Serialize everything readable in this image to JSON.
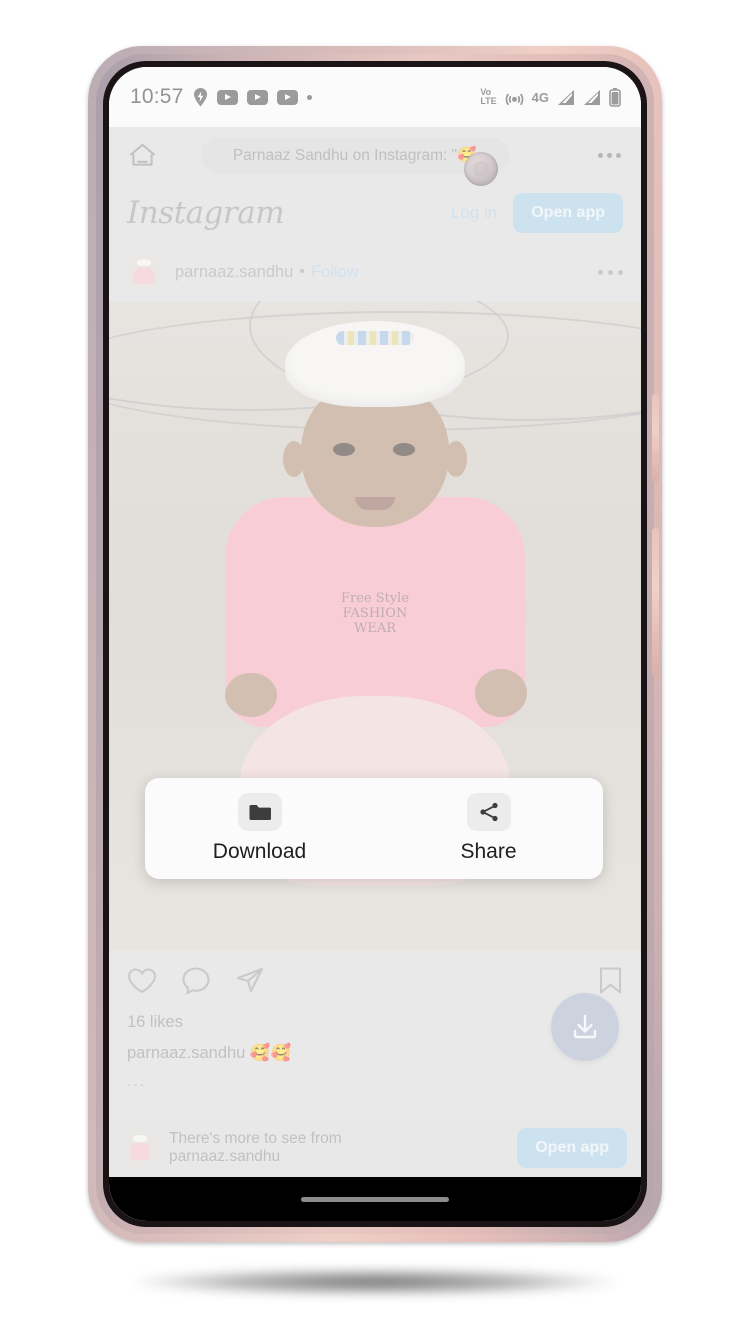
{
  "status_bar": {
    "time": "10:57",
    "left_icons": [
      "location-pin-icon",
      "youtube-icon",
      "youtube-icon",
      "youtube-icon",
      "dot-icon"
    ],
    "network_label": "VoLTE",
    "volte_line1": "Vo",
    "volte_line2": "LTE",
    "data_type": "4G",
    "right_icons": [
      "volte-icon",
      "hotspot-icon",
      "4g-label",
      "signal-bars-icon",
      "signal-bars-icon",
      "battery-icon"
    ]
  },
  "browser": {
    "home_icon": "home-icon",
    "url_text": "Parnaaz Sandhu on Instagram: \"🥰",
    "menu_icon": "overflow-menu-icon"
  },
  "instagram": {
    "logo": "Instagram",
    "login_label": "Log in",
    "open_app_label": "Open app",
    "post": {
      "username": "parnaaz.sandhu",
      "separator": "•",
      "follow_label": "Follow",
      "menu_icon": "overflow-menu-icon",
      "avatar": "user-avatar",
      "photo_alt": "toddler-photo",
      "likes": "16 likes",
      "caption": "parnaaz.sandhu 🥰🥰",
      "caption_more": "...",
      "action_icons": [
        "heart-icon",
        "comment-icon",
        "share-icon",
        "bookmark-icon"
      ]
    },
    "banner": {
      "line1": "There's more to see from",
      "line2": "parnaaz.sandhu",
      "button_label": "Open app"
    }
  },
  "floating_action": {
    "icon": "download-icon",
    "color": "#a4b0c4"
  },
  "share_dialog": {
    "options": [
      {
        "icon": "folder-icon",
        "label": "Download"
      },
      {
        "icon": "share-nodes-icon",
        "label": "Share"
      }
    ]
  },
  "colors": {
    "accent_blue": "#a5cbe2",
    "page_bg": "#d8d8d8",
    "dialog_bg": "#fbfbfb",
    "fab": "#a4b0c4",
    "text_muted": "#8f8f8f"
  }
}
